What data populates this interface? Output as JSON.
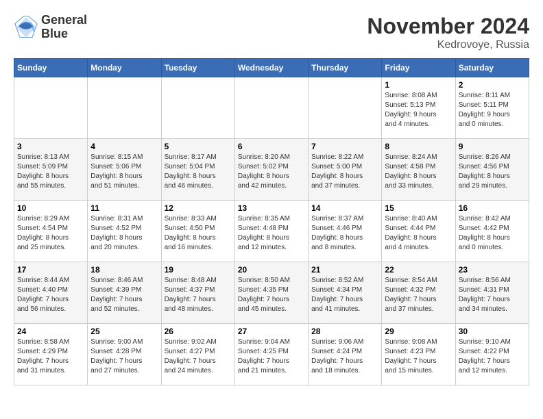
{
  "logo": {
    "line1": "General",
    "line2": "Blue"
  },
  "title": "November 2024",
  "subtitle": "Kedrovoye, Russia",
  "days_of_week": [
    "Sunday",
    "Monday",
    "Tuesday",
    "Wednesday",
    "Thursday",
    "Friday",
    "Saturday"
  ],
  "weeks": [
    [
      {
        "day": "",
        "info": ""
      },
      {
        "day": "",
        "info": ""
      },
      {
        "day": "",
        "info": ""
      },
      {
        "day": "",
        "info": ""
      },
      {
        "day": "",
        "info": ""
      },
      {
        "day": "1",
        "info": "Sunrise: 8:08 AM\nSunset: 5:13 PM\nDaylight: 9 hours\nand 4 minutes."
      },
      {
        "day": "2",
        "info": "Sunrise: 8:11 AM\nSunset: 5:11 PM\nDaylight: 9 hours\nand 0 minutes."
      }
    ],
    [
      {
        "day": "3",
        "info": "Sunrise: 8:13 AM\nSunset: 5:09 PM\nDaylight: 8 hours\nand 55 minutes."
      },
      {
        "day": "4",
        "info": "Sunrise: 8:15 AM\nSunset: 5:06 PM\nDaylight: 8 hours\nand 51 minutes."
      },
      {
        "day": "5",
        "info": "Sunrise: 8:17 AM\nSunset: 5:04 PM\nDaylight: 8 hours\nand 46 minutes."
      },
      {
        "day": "6",
        "info": "Sunrise: 8:20 AM\nSunset: 5:02 PM\nDaylight: 8 hours\nand 42 minutes."
      },
      {
        "day": "7",
        "info": "Sunrise: 8:22 AM\nSunset: 5:00 PM\nDaylight: 8 hours\nand 37 minutes."
      },
      {
        "day": "8",
        "info": "Sunrise: 8:24 AM\nSunset: 4:58 PM\nDaylight: 8 hours\nand 33 minutes."
      },
      {
        "day": "9",
        "info": "Sunrise: 8:26 AM\nSunset: 4:56 PM\nDaylight: 8 hours\nand 29 minutes."
      }
    ],
    [
      {
        "day": "10",
        "info": "Sunrise: 8:29 AM\nSunset: 4:54 PM\nDaylight: 8 hours\nand 25 minutes."
      },
      {
        "day": "11",
        "info": "Sunrise: 8:31 AM\nSunset: 4:52 PM\nDaylight: 8 hours\nand 20 minutes."
      },
      {
        "day": "12",
        "info": "Sunrise: 8:33 AM\nSunset: 4:50 PM\nDaylight: 8 hours\nand 16 minutes."
      },
      {
        "day": "13",
        "info": "Sunrise: 8:35 AM\nSunset: 4:48 PM\nDaylight: 8 hours\nand 12 minutes."
      },
      {
        "day": "14",
        "info": "Sunrise: 8:37 AM\nSunset: 4:46 PM\nDaylight: 8 hours\nand 8 minutes."
      },
      {
        "day": "15",
        "info": "Sunrise: 8:40 AM\nSunset: 4:44 PM\nDaylight: 8 hours\nand 4 minutes."
      },
      {
        "day": "16",
        "info": "Sunrise: 8:42 AM\nSunset: 4:42 PM\nDaylight: 8 hours\nand 0 minutes."
      }
    ],
    [
      {
        "day": "17",
        "info": "Sunrise: 8:44 AM\nSunset: 4:40 PM\nDaylight: 7 hours\nand 56 minutes."
      },
      {
        "day": "18",
        "info": "Sunrise: 8:46 AM\nSunset: 4:39 PM\nDaylight: 7 hours\nand 52 minutes."
      },
      {
        "day": "19",
        "info": "Sunrise: 8:48 AM\nSunset: 4:37 PM\nDaylight: 7 hours\nand 48 minutes."
      },
      {
        "day": "20",
        "info": "Sunrise: 8:50 AM\nSunset: 4:35 PM\nDaylight: 7 hours\nand 45 minutes."
      },
      {
        "day": "21",
        "info": "Sunrise: 8:52 AM\nSunset: 4:34 PM\nDaylight: 7 hours\nand 41 minutes."
      },
      {
        "day": "22",
        "info": "Sunrise: 8:54 AM\nSunset: 4:32 PM\nDaylight: 7 hours\nand 37 minutes."
      },
      {
        "day": "23",
        "info": "Sunrise: 8:56 AM\nSunset: 4:31 PM\nDaylight: 7 hours\nand 34 minutes."
      }
    ],
    [
      {
        "day": "24",
        "info": "Sunrise: 8:58 AM\nSunset: 4:29 PM\nDaylight: 7 hours\nand 31 minutes."
      },
      {
        "day": "25",
        "info": "Sunrise: 9:00 AM\nSunset: 4:28 PM\nDaylight: 7 hours\nand 27 minutes."
      },
      {
        "day": "26",
        "info": "Sunrise: 9:02 AM\nSunset: 4:27 PM\nDaylight: 7 hours\nand 24 minutes."
      },
      {
        "day": "27",
        "info": "Sunrise: 9:04 AM\nSunset: 4:25 PM\nDaylight: 7 hours\nand 21 minutes."
      },
      {
        "day": "28",
        "info": "Sunrise: 9:06 AM\nSunset: 4:24 PM\nDaylight: 7 hours\nand 18 minutes."
      },
      {
        "day": "29",
        "info": "Sunrise: 9:08 AM\nSunset: 4:23 PM\nDaylight: 7 hours\nand 15 minutes."
      },
      {
        "day": "30",
        "info": "Sunrise: 9:10 AM\nSunset: 4:22 PM\nDaylight: 7 hours\nand 12 minutes."
      }
    ]
  ]
}
